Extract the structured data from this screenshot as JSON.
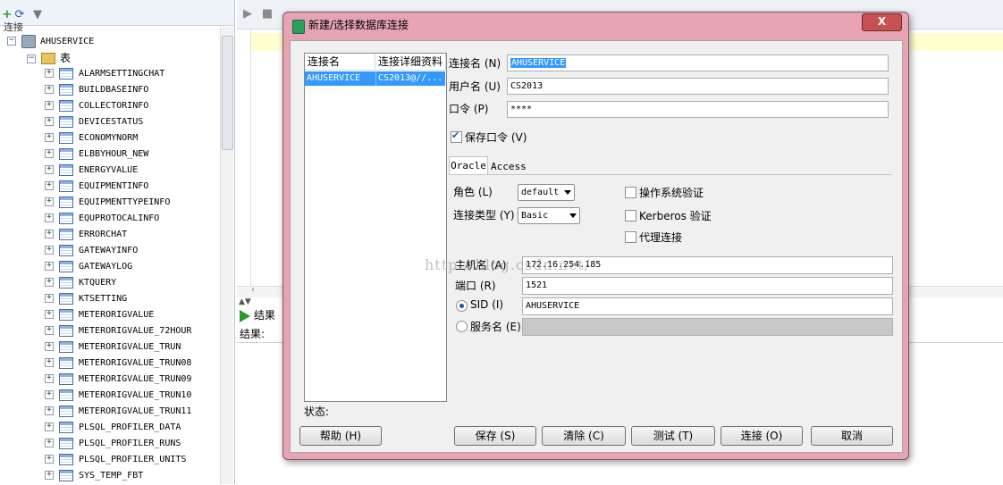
{
  "tree": {
    "connections_label": "连接",
    "root": "AHUSERVICE",
    "folder": "表",
    "tables": [
      "ALARMSETTINGCHAT",
      "BUILDBASEINFO",
      "COLLECTORINFO",
      "DEVICESTATUS",
      "ECONOMYNORM",
      "ELBBYHOUR_NEW",
      "ENERGYVALUE",
      "EQUIPMENTINFO",
      "EQUIPMENTTYPEINFO",
      "EQUPROTOCALINFO",
      "ERRORCHAT",
      "GATEWAYINFO",
      "GATEWAYLOG",
      "KTQUERY",
      "KTSETTING",
      "METERORIGVALUE",
      "METERORIGVALUE_72HOUR",
      "METERORIGVALUE_TRUN",
      "METERORIGVALUE_TRUN08",
      "METERORIGVALUE_TRUN09",
      "METERORIGVALUE_TRUN10",
      "METERORIGVALUE_TRUN11",
      "PLSQL_PROFILER_DATA",
      "PLSQL_PROFILER_RUNS",
      "PLSQL_PROFILER_UNITS",
      "SYS_TEMP_FBT"
    ]
  },
  "results": {
    "tab_label": "结果",
    "label": "结果:"
  },
  "dialog": {
    "title": "新建/选择数据库连接",
    "close_label": "X",
    "list": {
      "headers": [
        "连接名",
        "连接详细资料"
      ],
      "rows": [
        {
          "name": "AHUSERVICE",
          "details": "CS2013@//..."
        }
      ]
    },
    "conn_name": {
      "label": "连接名 (N)",
      "value": "AHUSERVICE"
    },
    "username": {
      "label": "用户名 (U)",
      "value": "CS2013"
    },
    "password": {
      "label": "口令 (P)",
      "value": "****"
    },
    "save_password": {
      "label": "保存口令 (V)",
      "checked": true
    },
    "tabs": [
      "Oracle",
      "Access"
    ],
    "role": {
      "label": "角色 (L)",
      "value": "default"
    },
    "conn_type": {
      "label": "连接类型 (Y)",
      "value": "Basic"
    },
    "os_auth": {
      "label": "操作系统验证",
      "checked": false
    },
    "kerberos": {
      "label": "Kerberos 验证",
      "checked": false
    },
    "proxy": {
      "label": "代理连接",
      "checked": false
    },
    "host": {
      "label": "主机名 (A)",
      "value": "172.16.254.185"
    },
    "port": {
      "label": "端口 (R)",
      "value": "1521"
    },
    "sid": {
      "label": "SID (I)",
      "value": "AHUSERVICE",
      "selected": true
    },
    "service_name": {
      "label": "服务名 (E)",
      "value": ""
    },
    "status_label": "状态:",
    "buttons": {
      "help": "帮助 (H)",
      "save": "保存 (S)",
      "clear": "清除 (C)",
      "test": "测试 (T)",
      "connect": "连接 (O)",
      "cancel": "取消"
    }
  },
  "watermark": "http://blog.csdn.net/",
  "colors": {
    "dialog_frame": "#e6a3b4",
    "selection": "#3399ff",
    "editor_line": "#ffffd0"
  }
}
